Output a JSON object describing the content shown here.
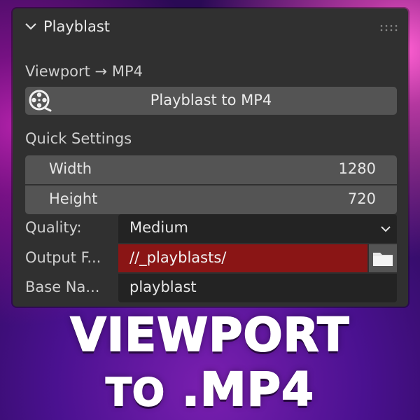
{
  "panel": {
    "title": "Playblast",
    "section_heading": "Viewport → MP4",
    "playblast_button": {
      "label": "Playblast to MP4",
      "icon": "film-reel-icon"
    },
    "quick_settings_heading": "Quick Settings",
    "width": {
      "label": "Width",
      "value": "1280"
    },
    "height": {
      "label": "Height",
      "value": "720"
    },
    "quality": {
      "label": "Quality:",
      "value": "Medium"
    },
    "output_folder": {
      "label": "Output F...",
      "value": "//_playblasts/"
    },
    "base_name": {
      "label": "Base Na...",
      "value": "playblast"
    }
  },
  "banner": {
    "line1": "VIEWPORT",
    "line2_prefix": "TO",
    "line2_main": ".MP4"
  },
  "colors": {
    "panel_bg": "#303030",
    "button_bg": "#545454",
    "field_bg": "#232323",
    "path_error_bg": "#8a1515",
    "text": "#d9d9d9"
  }
}
